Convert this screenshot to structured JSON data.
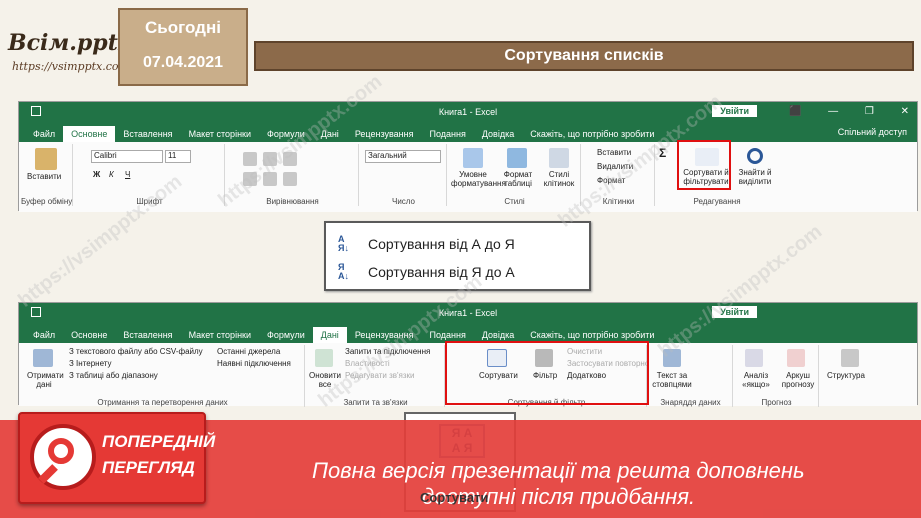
{
  "header": {
    "logo_text": "Всім.pptx",
    "logo_url": "https://vsimpptx.com",
    "today_label": "Сьогодні",
    "date": "07.04.2021",
    "slide_title": "Сортування списків"
  },
  "excel1": {
    "window_title": "Книга1 - Excel",
    "signin": "Увійти",
    "window_controls": [
      "⬛",
      "—",
      "❐",
      "✕"
    ],
    "tabs": [
      "Файл",
      "Основне",
      "Вставлення",
      "Макет сторінки",
      "Формули",
      "Дані",
      "Рецензування",
      "Подання",
      "Довідка",
      "Скажіть, що потрібно зробити"
    ],
    "active_tab": "Основне",
    "share": "Спільний доступ",
    "font_name": "Calibri",
    "font_size": "11",
    "number_format": "Загальний",
    "paste": "Вставити",
    "insert": "Вставити",
    "delete": "Видалити",
    "format": "Формат",
    "cond_format": "Умовне форматування",
    "format_table": "Формат таблиці",
    "cell_styles": "Стилі клітинок",
    "sort_filter": "Сортувати й фільтрувати",
    "find_select": "Знайти й виділити",
    "groups": [
      "Буфер обміну",
      "Шрифт",
      "Вирівнювання",
      "Число",
      "Стилі",
      "Клітинки",
      "Редагування"
    ]
  },
  "dropdown": {
    "items": [
      {
        "icon": "sort-ascending-icon",
        "label": "Сортування від А до Я"
      },
      {
        "icon": "sort-descending-icon",
        "label": "Сортування від Я до А"
      }
    ]
  },
  "excel2": {
    "window_title": "Книга1 - Excel",
    "signin": "Увійти",
    "tabs": [
      "Файл",
      "Основне",
      "Вставлення",
      "Макет сторінки",
      "Формули",
      "Дані",
      "Рецензування",
      "Подання",
      "Довідка",
      "Скажіть, що потрібно зробити"
    ],
    "active_tab": "Дані",
    "get_data": "Отримати дані",
    "from_csv": "З текстового файлу або CSV-файлу",
    "from_web": "З Інтернету",
    "from_table": "З таблиці або діапазону",
    "recent_sources": "Останні джерела",
    "existing_conn": "Наявні підключення",
    "refresh_all": "Оновити все",
    "queries_conn": "Запити та підключення",
    "properties": "Властивості",
    "edit_links": "Редагувати зв'язки",
    "sort": "Сортувати",
    "filter": "Фільтр",
    "clear": "Очистити",
    "reapply": "Застосувати повторно",
    "advanced": "Додатково",
    "text_to_columns": "Текст за стовпцями",
    "what_if": "Аналіз «якщо»",
    "forecast_sheet": "Аркуш прогнозу",
    "outline": "Структура",
    "groups": [
      "Отримання та перетворення даних",
      "Запити та зв'язки",
      "Сортування й фільтр",
      "Знаряддя даних",
      "Прогноз"
    ]
  },
  "sort_button": {
    "label": "Сортувати",
    "icon_top": "Я А",
    "icon_bottom": "А Я"
  },
  "preview": {
    "line1": "ПОПЕРЕДНІЙ",
    "line2": "ПЕРЕГЛЯД",
    "message1": "Повна версія презентації та решта доповнень",
    "message2": "доступні після придбання."
  },
  "watermark": "https://vsimpptx.com",
  "colors": {
    "excel_green": "#217346",
    "highlight_red": "#e01010",
    "banner_red": "#e43e3a",
    "title_brown": "#8c6a4a"
  }
}
